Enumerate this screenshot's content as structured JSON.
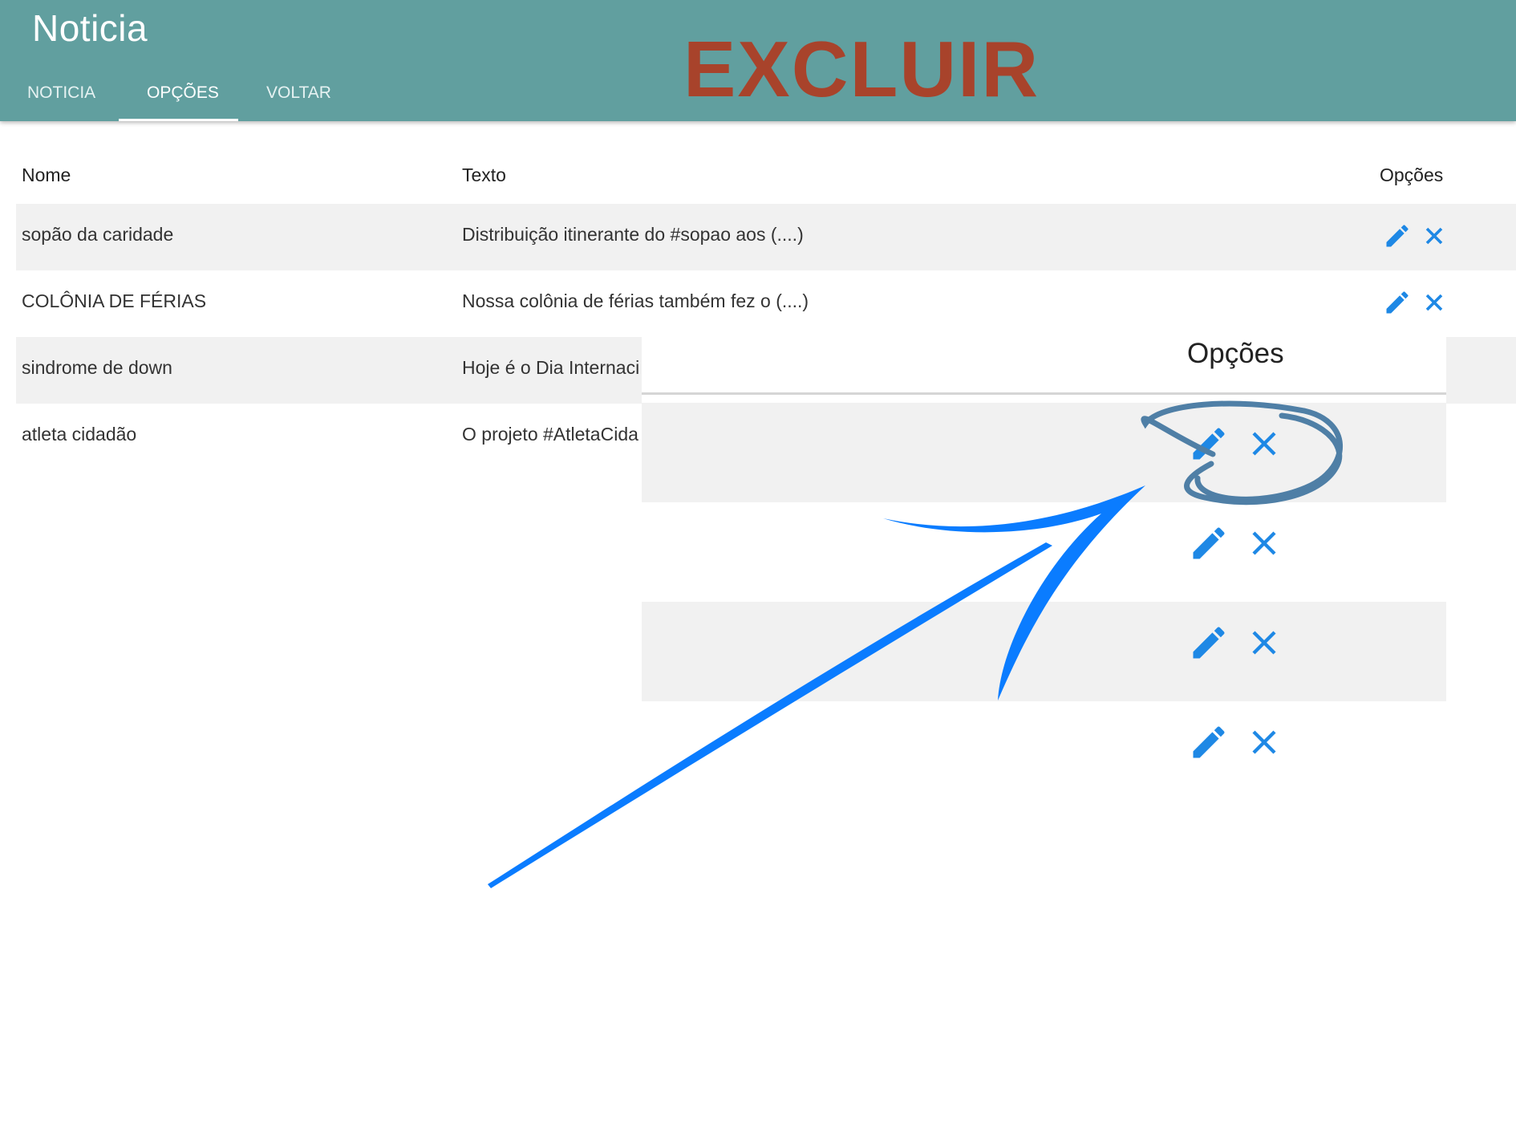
{
  "header": {
    "title": "Noticia",
    "annotation": "EXCLUIR",
    "tabs": [
      {
        "label": "NOTICIA"
      },
      {
        "label": "OPÇÕES"
      },
      {
        "label": "VOLTAR"
      }
    ],
    "active_tab": 1,
    "bar_color": "#619f9f"
  },
  "table": {
    "headers": {
      "name": "Nome",
      "text": "Texto",
      "options": "Opções"
    },
    "rows": [
      {
        "name": "sopão da caridade",
        "text": "Distribuição itinerante do #sopao aos (....)"
      },
      {
        "name": "COLÔNIA DE FÉRIAS",
        "text": "Nossa colônia de férias também fez o (....)"
      },
      {
        "name": "sindrome de down",
        "text": "Hoje é o Dia Internaci"
      },
      {
        "name": "atleta cidadão",
        "text": "O projeto #AtletaCida"
      }
    ],
    "icons": {
      "edit": "pencil-icon",
      "delete": "close-icon"
    },
    "icon_color": "#1e88e5"
  },
  "zoom": {
    "header_label": "Opções",
    "highlight_color": "#4f7fa6",
    "arrow_color": "#0a7cff"
  }
}
